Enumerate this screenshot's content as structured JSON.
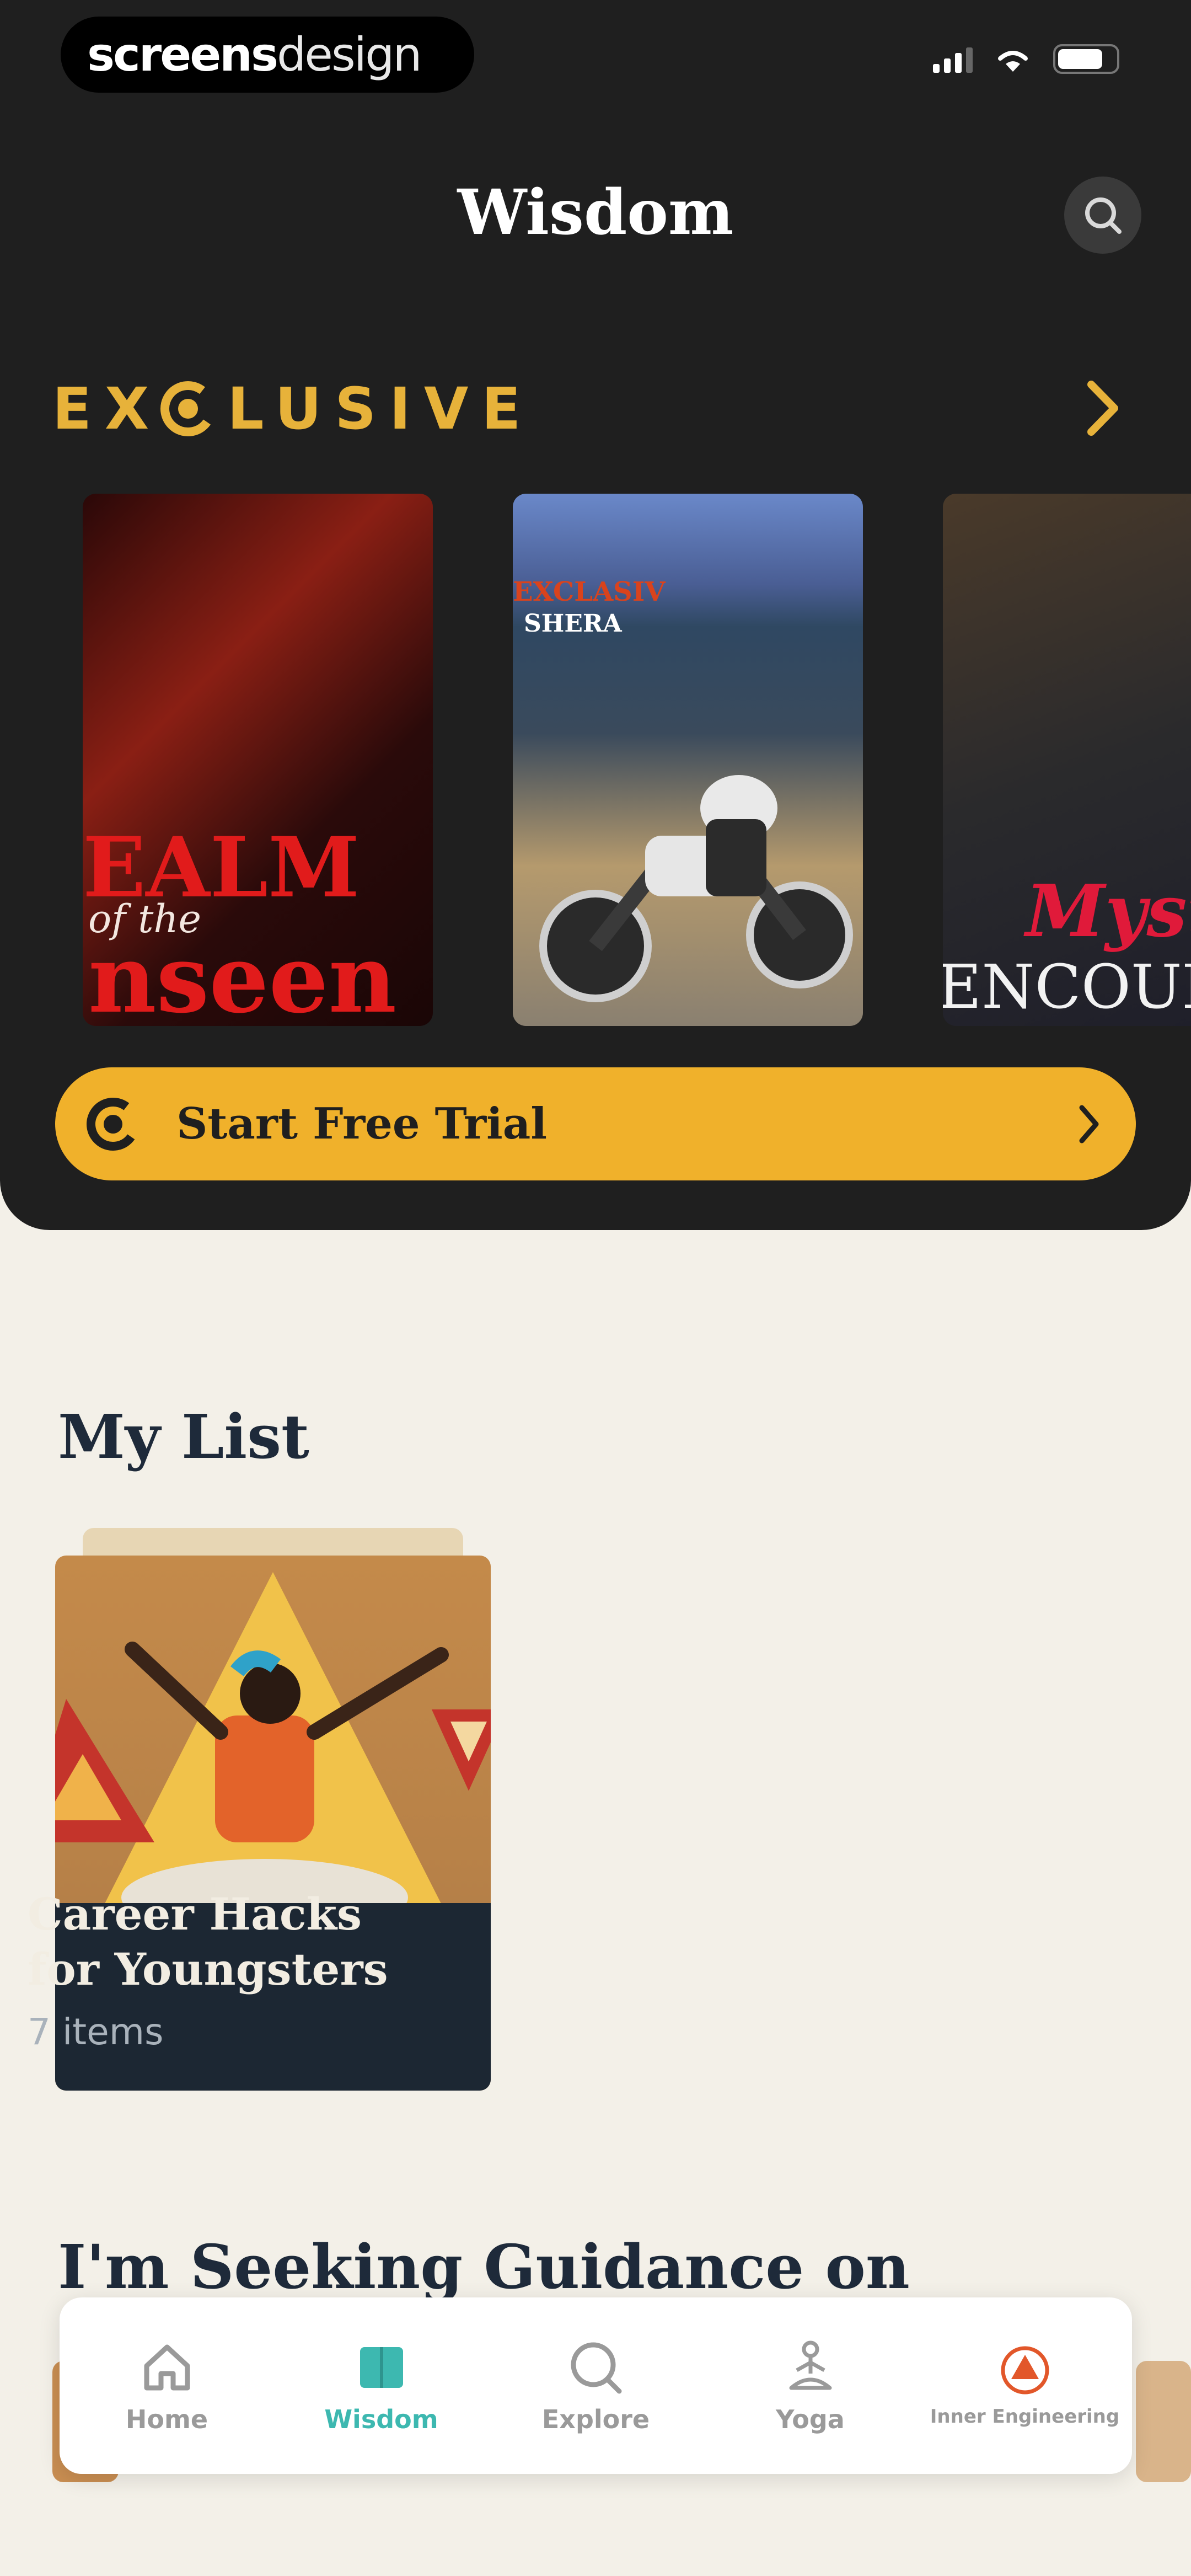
{
  "status_bar": {
    "brand_bold": "screens",
    "brand_light": "design"
  },
  "header": {
    "title": "Wisdom"
  },
  "exclusive": {
    "heading_left": "EX",
    "heading_right": "LUSIVE",
    "cards": [
      {
        "lines": [
          "EALM",
          "of the",
          "nseen"
        ]
      },
      {
        "lines": [
          "EXCLASIV",
          "SHERA"
        ]
      },
      {
        "lines": [
          "Myst",
          "ENCOUNT"
        ]
      }
    ]
  },
  "trial": {
    "label": "Start Free Trial"
  },
  "my_list": {
    "title": "My List",
    "card": {
      "name": "Career Hacks for Youngsters",
      "count": "7 items"
    }
  },
  "guidance": {
    "title": "I'm Seeking Guidance on"
  },
  "nav": {
    "items": [
      {
        "label": "Home",
        "icon": "home-icon"
      },
      {
        "label": "Wisdom",
        "icon": "book-icon"
      },
      {
        "label": "Explore",
        "icon": "search-icon"
      },
      {
        "label": "Yoga",
        "icon": "yoga-icon"
      },
      {
        "label": "Inner Engineering",
        "icon": "inner-engineering-icon"
      }
    ],
    "active_index": 1
  },
  "colors": {
    "accent": "#f0b12b",
    "dark_bg": "#1f1f1f",
    "page_bg": "#f3f0e8",
    "active_tab": "#3db8b0"
  }
}
